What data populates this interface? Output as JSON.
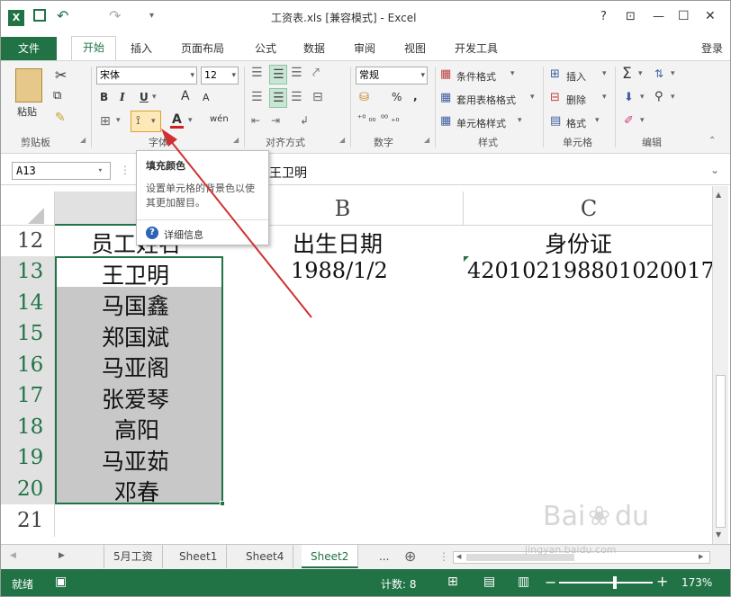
{
  "window": {
    "title": "工资表.xls  [兼容模式] - Excel",
    "help": "?",
    "restore_ribbon": "⊡",
    "minimize": "—",
    "maximize": "☐",
    "close": "✕",
    "undo": "↶",
    "redo": "↷",
    "qat_more": "▾"
  },
  "tabs": [
    {
      "label": "文件"
    },
    {
      "label": "开始"
    },
    {
      "label": "插入"
    },
    {
      "label": "页面布局"
    },
    {
      "label": "公式"
    },
    {
      "label": "数据"
    },
    {
      "label": "审阅"
    },
    {
      "label": "视图"
    },
    {
      "label": "开发工具"
    }
  ],
  "login": "登录",
  "ribbon": {
    "clipboard": {
      "paste": "粘贴",
      "label": "剪贴板"
    },
    "font": {
      "name": "宋体",
      "size": "12",
      "bold": "B",
      "italic": "I",
      "underline": "U",
      "grow": "A",
      "shrink": "A",
      "wen": "wén",
      "label": "字体"
    },
    "align": {
      "label": "对齐方式"
    },
    "number": {
      "format": "常规",
      "percent": "%",
      "comma": ",",
      "label": "数字"
    },
    "styles": {
      "cond": "条件格式",
      "table": "套用表格格式",
      "cell": "单元格样式",
      "label": "样式"
    },
    "cells": {
      "insert": "插入",
      "delete": "删除",
      "format": "格式",
      "label": "单元格"
    },
    "edit": {
      "sum": "Σ",
      "label": "编辑"
    }
  },
  "formula": {
    "namebox": "A13",
    "value": "王卫明",
    "fx": "fx",
    "cancel": "✕",
    "enter": "✓"
  },
  "tooltip": {
    "title": "填充颜色",
    "body": "设置单元格的背景色以使其更加醒目。",
    "more": "详细信息",
    "info_icon": "?"
  },
  "columns": [
    "A",
    "B",
    "C"
  ],
  "rows": [
    {
      "num": "12",
      "a": "员工姓名",
      "b": "出生日期",
      "c": "身份证"
    },
    {
      "num": "13",
      "a": "王卫明",
      "b": "1988/1/2",
      "c": "420102198801020017"
    },
    {
      "num": "14",
      "a": "马国鑫",
      "b": "",
      "c": ""
    },
    {
      "num": "15",
      "a": "郑国斌",
      "b": "",
      "c": ""
    },
    {
      "num": "16",
      "a": "马亚阁",
      "b": "",
      "c": ""
    },
    {
      "num": "17",
      "a": "张爱琴",
      "b": "",
      "c": ""
    },
    {
      "num": "18",
      "a": "高阳",
      "b": "",
      "c": ""
    },
    {
      "num": "19",
      "a": "马亚茹",
      "b": "",
      "c": ""
    },
    {
      "num": "20",
      "a": "邓春",
      "b": "",
      "c": ""
    },
    {
      "num": "21",
      "a": "",
      "b": "",
      "c": ""
    }
  ],
  "sheets": [
    "5月工资",
    "Sheet1",
    "Sheet4",
    "Sheet2"
  ],
  "sheet_more": "...",
  "sheet_add": "⊕",
  "status": {
    "mode": "就绪",
    "count": "计数: 8",
    "zoom": "173%"
  },
  "watermark": {
    "line1": "Baidu经验",
    "line2": "jingyan.baidu.com"
  },
  "colors": {
    "excel_green": "#217346",
    "selection_fill": "#c8c8c8",
    "arrow": "#d03030"
  }
}
